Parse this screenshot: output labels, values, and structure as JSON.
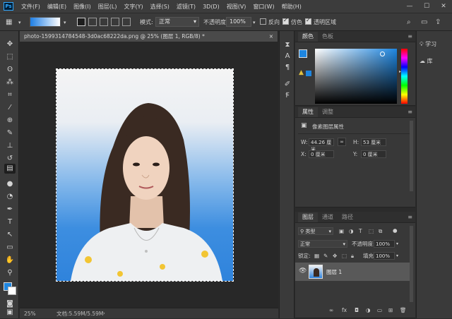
{
  "app": {
    "logo": "Ps"
  },
  "menu": [
    "文件(F)",
    "编辑(E)",
    "图像(I)",
    "图层(L)",
    "文字(Y)",
    "选择(S)",
    "滤镜(T)",
    "3D(D)",
    "视图(V)",
    "窗口(W)",
    "帮助(H)"
  ],
  "window_controls": {
    "minimize": "—",
    "maximize": "☐",
    "close": "✕"
  },
  "options": {
    "mode_label": "模式:",
    "mode_value": "正常",
    "opacity_label": "不透明度:",
    "opacity_value": "100%",
    "reverse_label": "反向",
    "reverse_checked": false,
    "dither_label": "仿色",
    "dither_checked": true,
    "transparency_label": "透明区域",
    "transparency_checked": true,
    "gradient_colors": [
      "#1e7fe6",
      "#ffffff"
    ]
  },
  "document": {
    "tab_title": "photo-1599314784548-3d0ac68222da.png @ 25% (图层 1, RGB/8) *",
    "close": "×",
    "zoom": "25%",
    "doc_info": "文档:5.59M/5.59M"
  },
  "colors": {
    "foreground": "#1e86e0",
    "background": "#ffffff"
  },
  "color_panel": {
    "tabs": [
      "颜色",
      "色板"
    ],
    "active": 0,
    "current_color": "#1e86e0"
  },
  "properties_panel": {
    "tabs": [
      "属性",
      "调整"
    ],
    "active": 0,
    "type_label": "像素图层属性",
    "w_label": "W:",
    "w_value": "44.26 厘米",
    "h_label": "H:",
    "h_value": "53 厘米",
    "x_label": "X:",
    "x_value": "0 厘米",
    "y_label": "Y:",
    "y_value": "0 厘米"
  },
  "layers_panel": {
    "tabs": [
      "图层",
      "通道",
      "路径"
    ],
    "active": 0,
    "filter_label": "类型",
    "blend_mode": "正常",
    "opacity_label": "不透明度:",
    "opacity_value": "100%",
    "lock_label": "锁定:",
    "fill_label": "填充:",
    "fill_value": "100%",
    "layers": [
      {
        "name": "图层 1",
        "visible": true,
        "selected": true
      }
    ]
  },
  "right_panels": [
    {
      "label": "学习",
      "icon": "lightbulb-icon"
    },
    {
      "label": "库",
      "icon": "cloud-icon"
    }
  ]
}
